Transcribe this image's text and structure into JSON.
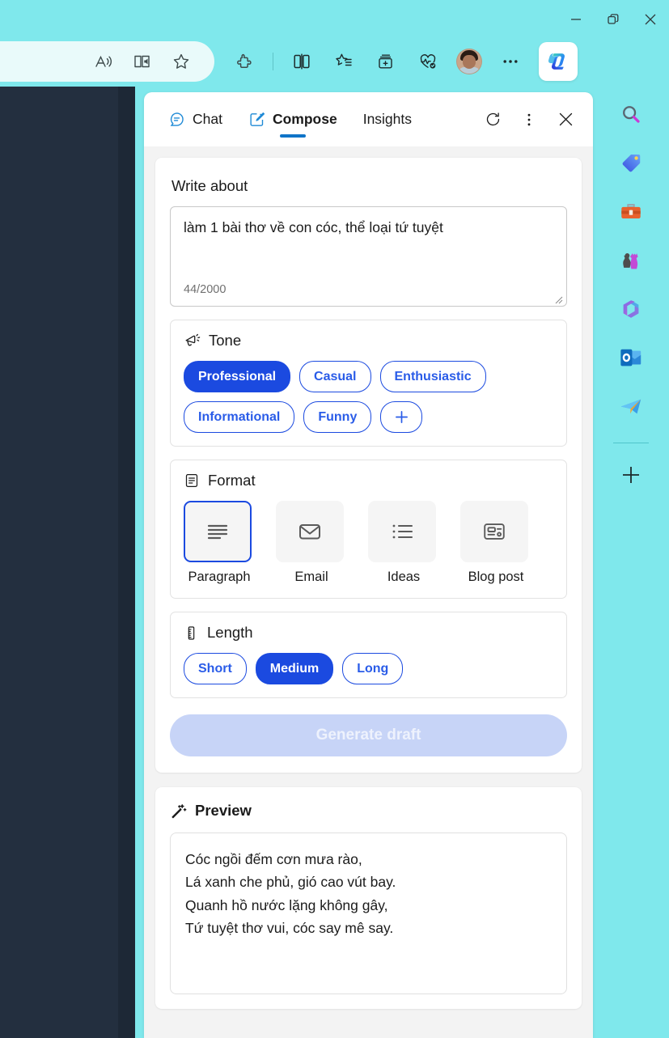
{
  "window": {
    "minimize_label": "Minimize",
    "restore_label": "Restore",
    "close_label": "Close"
  },
  "browser_toolbar": {
    "icons": [
      {
        "name": "read-aloud-icon",
        "label": "Read aloud"
      },
      {
        "name": "immersive-reader-icon",
        "label": "Enter Immersive Reader"
      },
      {
        "name": "favorite-star-icon",
        "label": "Add this page to favorites"
      },
      {
        "name": "extensions-icon",
        "label": "Extensions"
      },
      {
        "name": "split-screen-icon",
        "label": "Split screen"
      },
      {
        "name": "favorites-list-icon",
        "label": "Favorites"
      },
      {
        "name": "collections-icon",
        "label": "Collections"
      },
      {
        "name": "browser-essentials-icon",
        "label": "Browser essentials"
      },
      {
        "name": "profile-avatar",
        "label": "Profile"
      },
      {
        "name": "settings-more-icon",
        "label": "Settings and more"
      },
      {
        "name": "copilot-icon",
        "label": "Copilot"
      }
    ]
  },
  "side_rail": {
    "items": [
      {
        "name": "search-icon",
        "label": "Search"
      },
      {
        "name": "shopping-tag-icon",
        "label": "Shopping"
      },
      {
        "name": "tools-briefcase-icon",
        "label": "Tools"
      },
      {
        "name": "games-chess-icon",
        "label": "Games"
      },
      {
        "name": "microsoft365-icon",
        "label": "Microsoft 365"
      },
      {
        "name": "outlook-icon",
        "label": "Outlook"
      },
      {
        "name": "telegram-plane-icon",
        "label": "Telegram"
      },
      {
        "name": "add-sidebar-icon",
        "label": "Customize"
      }
    ]
  },
  "panel": {
    "tabs": [
      {
        "label": "Chat",
        "icon": "chat-bubble-icon",
        "active": false
      },
      {
        "label": "Compose",
        "icon": "compose-pencil-icon",
        "active": true
      },
      {
        "label": "Insights",
        "icon": "",
        "active": false
      }
    ],
    "actions": [
      {
        "name": "refresh-icon",
        "label": "Refresh"
      },
      {
        "name": "more-options-icon",
        "label": "More options"
      },
      {
        "name": "close-icon",
        "label": "Close"
      }
    ]
  },
  "compose": {
    "write_about_label": "Write about",
    "prompt_value": "làm 1 bài thơ về con cóc, thể loại tứ tuyệt",
    "prompt_placeholder": "Write about",
    "char_count": "44/2000",
    "tone": {
      "title": "Tone",
      "icon": "megaphone-icon",
      "options": [
        {
          "label": "Professional",
          "selected": true
        },
        {
          "label": "Casual",
          "selected": false
        },
        {
          "label": "Enthusiastic",
          "selected": false
        },
        {
          "label": "Informational",
          "selected": false
        },
        {
          "label": "Funny",
          "selected": false
        }
      ],
      "add_label": "+"
    },
    "format": {
      "title": "Format",
      "icon": "document-format-icon",
      "options": [
        {
          "label": "Paragraph",
          "icon": "paragraph-lines-icon",
          "selected": true
        },
        {
          "label": "Email",
          "icon": "envelope-icon",
          "selected": false
        },
        {
          "label": "Ideas",
          "icon": "bullet-list-icon",
          "selected": false
        },
        {
          "label": "Blog post",
          "icon": "blog-post-icon",
          "selected": false
        }
      ]
    },
    "length": {
      "title": "Length",
      "icon": "ruler-icon",
      "options": [
        {
          "label": "Short",
          "selected": false
        },
        {
          "label": "Medium",
          "selected": true
        },
        {
          "label": "Long",
          "selected": false
        }
      ]
    },
    "generate_label": "Generate draft"
  },
  "preview": {
    "title": "Preview",
    "icon": "magic-wand-icon",
    "lines": [
      "Cóc ngồi đếm cơn mưa rào,",
      "Lá xanh che phủ, gió cao vút bay.",
      "Quanh hồ nước lặng không gây,",
      "Tứ tuyệt thơ vui, cóc say mê say."
    ]
  },
  "colors": {
    "accent_blue": "#1b4ae0",
    "tab_underline": "#0f74c8",
    "browser_chrome": "#7FE8EC",
    "toolbar_pill": "#E9FAFA",
    "page_background": "#232f3f"
  }
}
